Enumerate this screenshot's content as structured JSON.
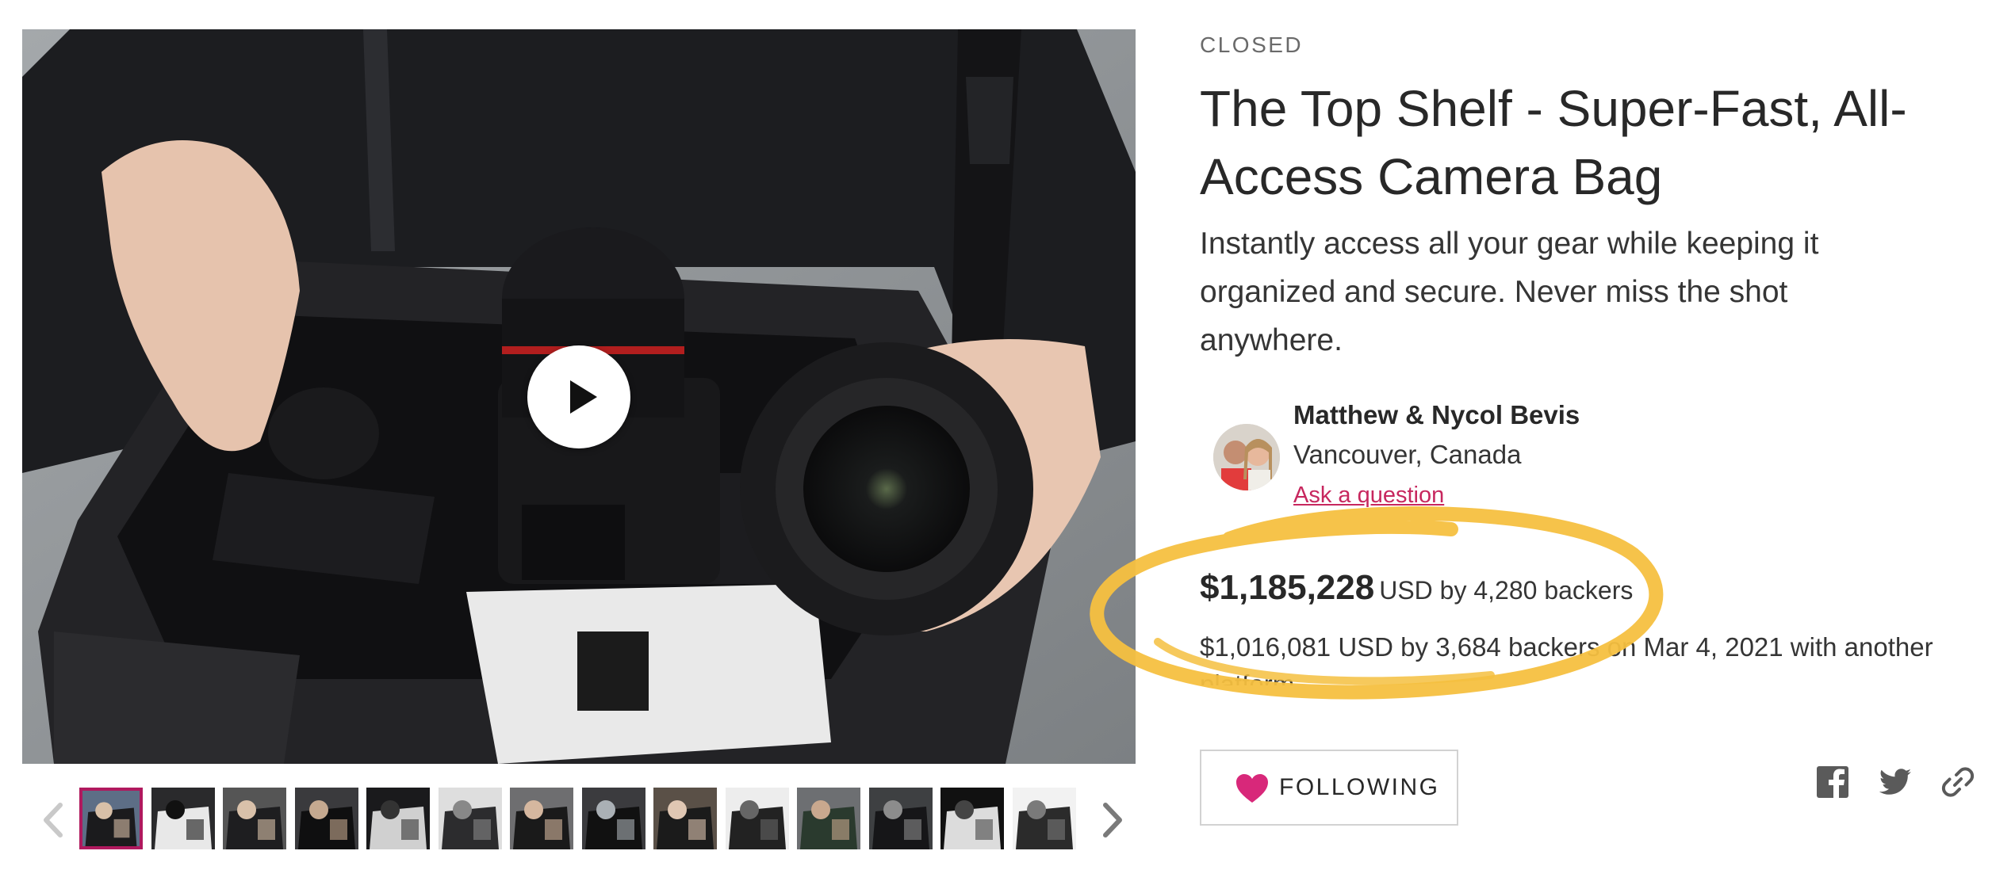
{
  "project": {
    "status": "CLOSED",
    "title": "The Top Shelf - Super-Fast, All-Access Camera Bag",
    "blurb": "Instantly access all your gear while keeping it organized and secure. Never miss the shot anywhere."
  },
  "creator": {
    "name": "Matthew & Nycol Bevis",
    "location": "Vancouver, Canada",
    "ask_link": "Ask a question"
  },
  "funding": {
    "pledged_amount": "$1,185,228",
    "pledged_suffix": "USD by 4,280 backers",
    "other_platform_note": "$1,016,081 USD by 3,684 backers on Mar 4, 2021 with another platform"
  },
  "media": {
    "play_icon": "play-icon",
    "thumbnail_count": 14,
    "active_thumbnail": 1,
    "prev_icon": "chevron-left-icon",
    "next_icon": "chevron-right-icon"
  },
  "actions": {
    "follow_label": "FOLLOWING",
    "follow_icon": "heart-icon",
    "share_icons": [
      "facebook-icon",
      "twitter-icon",
      "link-icon"
    ]
  },
  "colors": {
    "accent_pink": "#c7275e",
    "highlight_yellow": "#f5c040",
    "text_dark": "#282828",
    "muted": "#6a6a6a"
  }
}
